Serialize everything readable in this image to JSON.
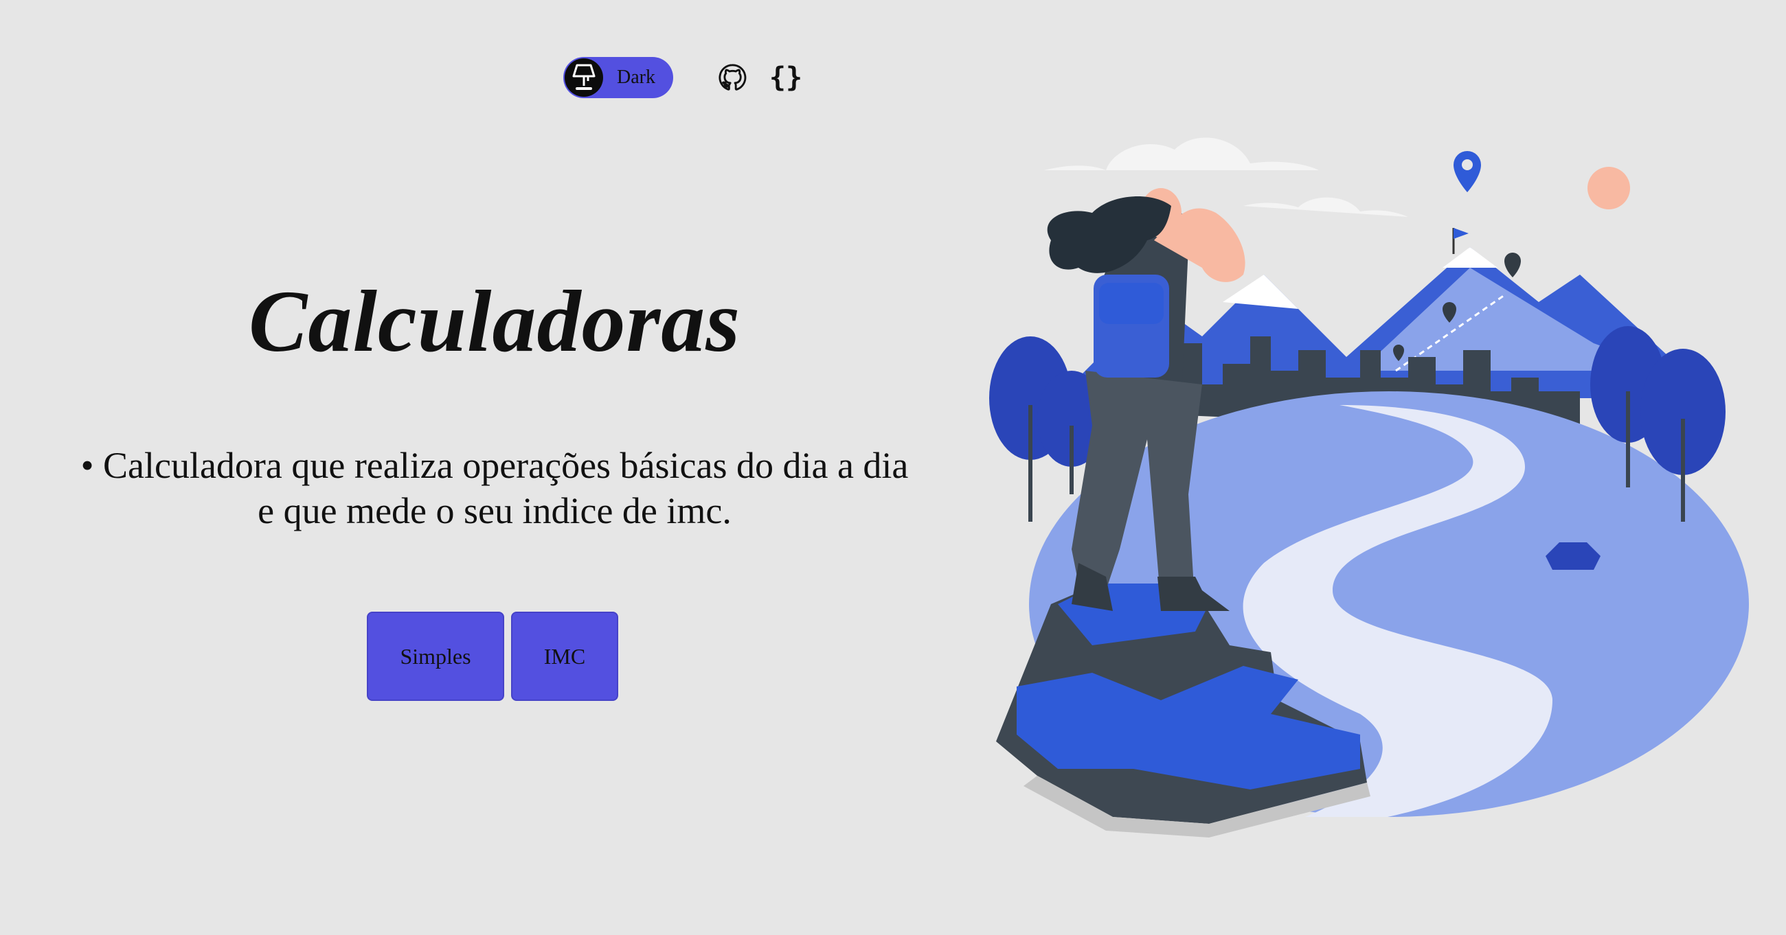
{
  "header": {
    "theme_toggle_label": "Dark",
    "github_icon": "github-icon",
    "code_icon": "code-braces-icon",
    "code_glyph": "{}"
  },
  "hero": {
    "title": "Calculadoras",
    "description_line1": "• Calculadora que realiza operações básicas do dia a dia",
    "description_line2": "e que mede o seu indice de imc."
  },
  "buttons": {
    "simples_label": "Simples",
    "imc_label": "IMC"
  },
  "colors": {
    "background": "#e6e6e6",
    "accent": "#5350e0",
    "illustration_blue": "#2f5bd8",
    "illustration_light": "#8aa3ea"
  }
}
